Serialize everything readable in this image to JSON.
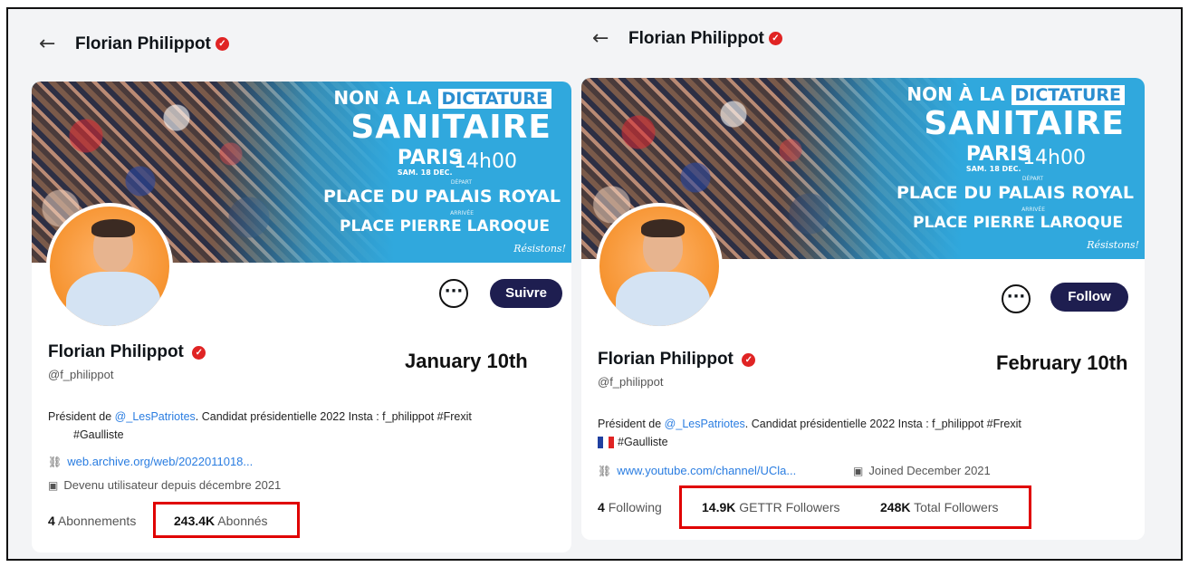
{
  "left": {
    "top_title": "Florian Philippot",
    "poster": {
      "line1_prefix": "NON À LA",
      "line1_highlight": "DICTATURE",
      "line2": "SANITAIRE",
      "city": "PARIS",
      "date": "SAM. 18 DEC.",
      "hour": "14h00",
      "depart": "DÉPART",
      "place1": "PLACE DU PALAIS ROYAL",
      "arrivee": "ARRIVÉE",
      "place2": "PLACE PIERRE LAROQUE",
      "signature": "Résistons!"
    },
    "more_label": "···",
    "follow_label": "Suivre",
    "display_name": "Florian Philippot",
    "handle": "@f_philippot",
    "date_label": "January 10th",
    "bio_prefix": "Président de ",
    "bio_mention": "@_LesPatriotes",
    "bio_suffix": ". Candidat présidentielle 2022 Insta : f_philippot #Frexit",
    "bio_line2": "#Gaulliste",
    "website": "web.archive.org/web/2022011018...",
    "joined": "Devenu utilisateur depuis décembre 2021",
    "following_count": "4",
    "following_label": "Abonnements",
    "followers_count": "243.4K",
    "followers_label": "Abonnés"
  },
  "right": {
    "top_title": "Florian Philippot",
    "poster": {
      "line1_prefix": "NON À LA",
      "line1_highlight": "DICTATURE",
      "line2": "SANITAIRE",
      "city": "PARIS",
      "date": "SAM. 18 DEC.",
      "hour": "14h00",
      "depart": "DÉPART",
      "place1": "PLACE DU PALAIS ROYAL",
      "arrivee": "ARRIVÉE",
      "place2": "PLACE PIERRE LAROQUE",
      "signature": "Résistons!"
    },
    "more_label": "···",
    "follow_label": "Follow",
    "display_name": "Florian Philippot",
    "handle": "@f_philippot",
    "date_label": "February 10th",
    "bio_prefix": "Président de ",
    "bio_mention": "@_LesPatriotes",
    "bio_suffix": ". Candidat présidentielle 2022 Insta : f_philippot #Frexit",
    "bio_line2": "#Gaulliste",
    "website": "www.youtube.com/channel/UCla...",
    "joined": "Joined December 2021",
    "following_count": "4",
    "following_label": "Following",
    "gettr_followers_count": "14.9K",
    "gettr_followers_label": "GETTR Followers",
    "total_followers_count": "248K",
    "total_followers_label": "Total Followers"
  },
  "colors": {
    "accent_red": "#e00000",
    "button_navy": "#1e1e50",
    "link_blue": "#2a7de1",
    "banner_blue": "#30a8dd"
  },
  "icons": [
    "back-arrow-icon",
    "verified-badge-icon",
    "link-icon",
    "calendar-icon",
    "more-options-icon",
    "france-flag-icon"
  ]
}
